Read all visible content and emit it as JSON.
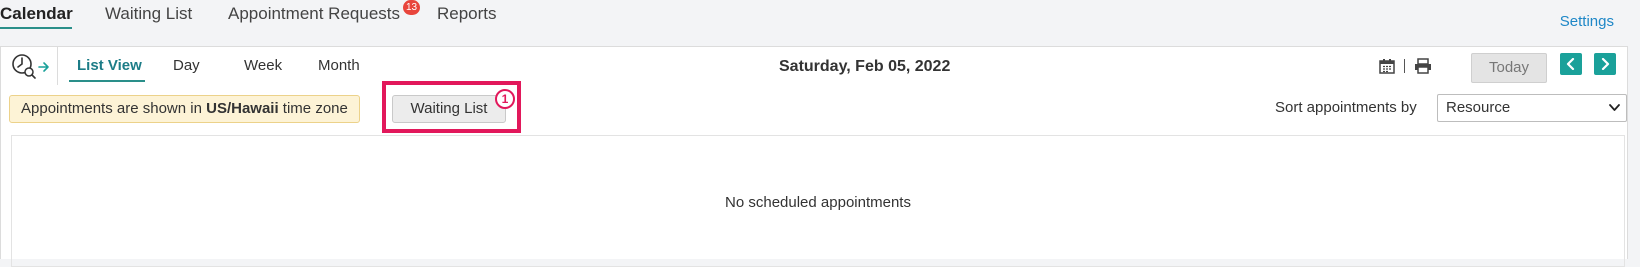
{
  "topnav": {
    "tabs": [
      {
        "label": "Calendar",
        "active": true
      },
      {
        "label": "Waiting List"
      },
      {
        "label": "Appointment Requests",
        "badge": "13"
      },
      {
        "label": "Reports"
      }
    ],
    "settings": "Settings"
  },
  "toolbar": {
    "views": [
      {
        "label": "List View",
        "active": true
      },
      {
        "label": "Day"
      },
      {
        "label": "Week"
      },
      {
        "label": "Month"
      }
    ],
    "date_title": "Saturday, Feb 05, 2022",
    "today_label": "Today",
    "icons": [
      "clock-search-icon",
      "calendar-icon",
      "print-icon",
      "chevron-left-icon",
      "chevron-right-icon"
    ]
  },
  "timezone_note": {
    "prefix": "Appointments are shown in ",
    "zone": "US/Hawaii",
    "suffix": " time zone"
  },
  "waiting_list_button": {
    "label": "Waiting List",
    "annotation_number": "1"
  },
  "sort": {
    "label": "Sort appointments by",
    "selected": "Resource"
  },
  "content": {
    "empty_message": "No scheduled appointments"
  },
  "colors": {
    "accent": "#1aa19a",
    "link": "#1e87c7",
    "highlight": "#e2185b",
    "badge": "#e8453c"
  }
}
